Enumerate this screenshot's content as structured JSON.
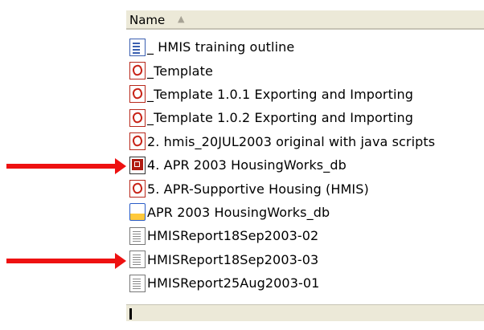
{
  "header": {
    "column_label": "Name",
    "sort_icon": "sort-ascending-icon"
  },
  "files": [
    {
      "name": "_ HMIS training outline",
      "icon": "document-icon",
      "icon_class": "doc"
    },
    {
      "name": "_Template",
      "icon": "pdf-icon",
      "icon_class": "pdf"
    },
    {
      "name": "_Template 1.0.1  Exporting and Importing",
      "icon": "pdf-icon",
      "icon_class": "pdf"
    },
    {
      "name": "_Template 1.0.2  Exporting and Importing",
      "icon": "pdf-icon",
      "icon_class": "pdf"
    },
    {
      "name": "2. hmis_20JUL2003 original with java scripts",
      "icon": "pdf-icon",
      "icon_class": "pdf"
    },
    {
      "name": "4. APR 2003 HousingWorks_db",
      "icon": "pdf-form-icon",
      "icon_class": "pdf-fill",
      "highlighted": true
    },
    {
      "name": "5. APR-Supportive Housing (HMIS)",
      "icon": "pdf-icon",
      "icon_class": "pdf"
    },
    {
      "name": "APR 2003 HousingWorks_db",
      "icon": "application-icon",
      "icon_class": "app"
    },
    {
      "name": "HMISReport18Sep2003-02",
      "icon": "text-file-icon",
      "icon_class": "txt"
    },
    {
      "name": "HMISReport18Sep2003-03",
      "icon": "text-file-icon",
      "icon_class": "txt",
      "highlighted": true
    },
    {
      "name": "HMISReport25Aug2003-01",
      "icon": "text-file-icon",
      "icon_class": "txt"
    }
  ],
  "annotation_color": "#ee1111"
}
